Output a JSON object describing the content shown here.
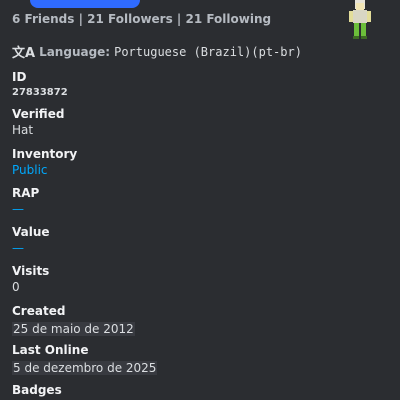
{
  "header": {
    "stats": "6 Friends | 21 Followers | 21 Following"
  },
  "language": {
    "icon": "translate-icon",
    "label": "Language:",
    "value": "Portuguese (Brazil)(pt-br)"
  },
  "fields": {
    "id": {
      "name": "ID",
      "value": "27833872"
    },
    "verified": {
      "name": "Verified",
      "value": "Hat"
    },
    "inventory": {
      "name": "Inventory",
      "value": "Public"
    },
    "rap": {
      "name": "RAP",
      "value": "—"
    },
    "value": {
      "name": "Value",
      "value": "—"
    },
    "visits": {
      "name": "Visits",
      "value": "0"
    },
    "created": {
      "name": "Created",
      "value": "25 de maio de 2012"
    },
    "last_online": {
      "name": "Last Online",
      "value": "5 de dezembro de 2025"
    },
    "badges": {
      "name": "Badges"
    }
  },
  "colors": {
    "background": "#2b2d31",
    "link": "#00a8fc",
    "redaction": "#2f6bff"
  }
}
